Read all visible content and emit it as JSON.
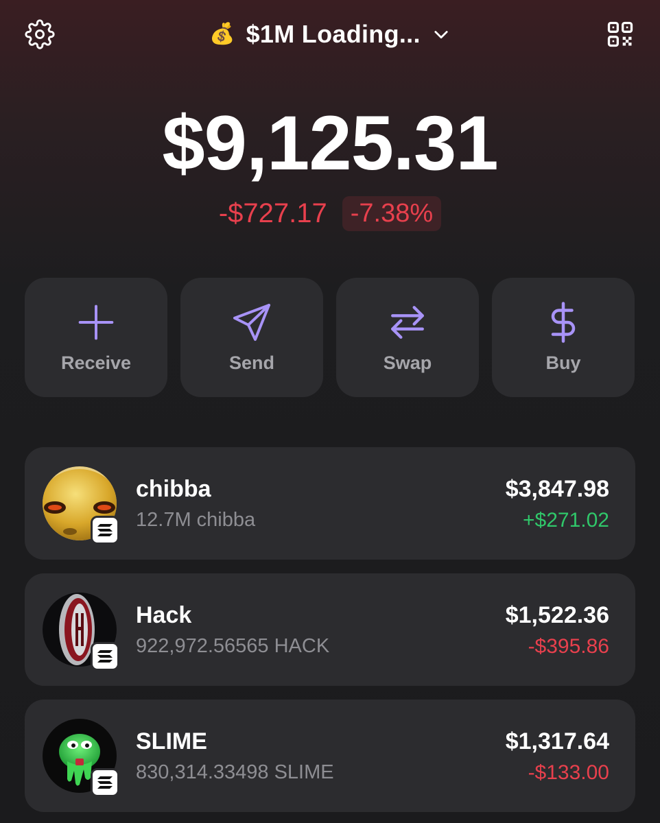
{
  "header": {
    "account_emoji": "💰",
    "account_name": "$1M Loading...",
    "settings_icon": "gear-icon",
    "qr_icon": "qr-code-icon"
  },
  "balance": {
    "total": "$9,125.31",
    "change_amount": "-$727.17",
    "change_percent": "-7.38%"
  },
  "actions": [
    {
      "label": "Receive",
      "icon": "plus-icon"
    },
    {
      "label": "Send",
      "icon": "paper-plane-icon"
    },
    {
      "label": "Swap",
      "icon": "swap-arrows-icon"
    },
    {
      "label": "Buy",
      "icon": "dollar-icon"
    }
  ],
  "tokens": [
    {
      "name": "chibba",
      "amount": "12.7M chibba",
      "value": "$3,847.98",
      "change": "+$271.02",
      "direction": "up"
    },
    {
      "name": "Hack",
      "amount": "922,972.56565 HACK",
      "value": "$1,522.36",
      "change": "-$395.86",
      "direction": "down"
    },
    {
      "name": "SLIME",
      "amount": "830,314.33498 SLIME",
      "value": "$1,317.64",
      "change": "-$133.00",
      "direction": "down"
    }
  ],
  "colors": {
    "accent": "#a893f7",
    "positive": "#30c76a",
    "negative": "#e8404d",
    "card": "#2c2c2f"
  }
}
